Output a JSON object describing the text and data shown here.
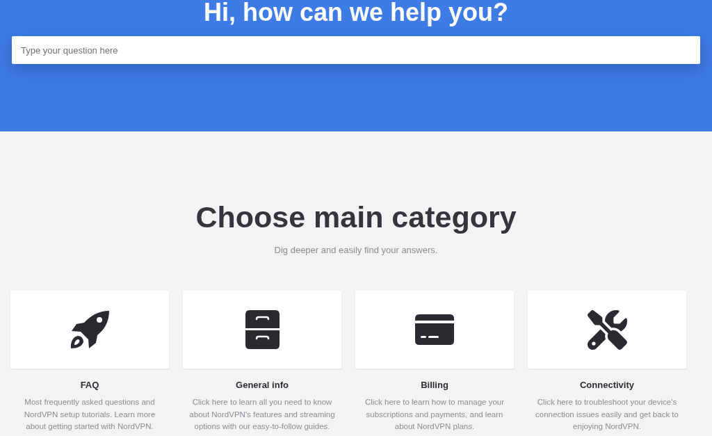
{
  "header": {
    "title": "Hi, how can we help you?",
    "search": {
      "placeholder": "Type your question here"
    }
  },
  "categories_section": {
    "heading": "Choose main category",
    "subheading": "Dig deeper and easily find your answers.",
    "categories": [
      {
        "title": "FAQ",
        "description": "Most frequently asked questions and NordVPN setup tutorials. Learn more about getting started with NordVPN."
      },
      {
        "title": "General info",
        "description": "Click here to learn all you need to know about NordVPN's features and streaming options with our easy-to-follow guides."
      },
      {
        "title": "Billing",
        "description": "Click here to learn how to manage your subscriptions and payments, and learn about NordVPN plans."
      },
      {
        "title": "Connectivity",
        "description": "Click here to troubleshoot your device's connection issues easily and get back to enjoying NordVPN."
      }
    ]
  }
}
